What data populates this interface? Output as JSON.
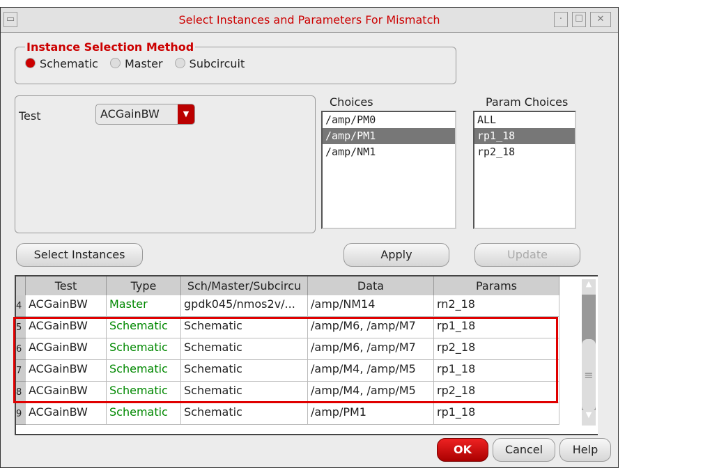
{
  "window": {
    "title": "Select Instances and Parameters For Mismatch"
  },
  "method": {
    "legend": "Instance Selection Method",
    "options": [
      {
        "label": "Schematic",
        "selected": true
      },
      {
        "label": "Master",
        "selected": false
      },
      {
        "label": "Subcircuit",
        "selected": false
      }
    ]
  },
  "test": {
    "label": "Test",
    "value": "ACGainBW"
  },
  "choices": {
    "label": "Choices",
    "items": [
      "/amp/PM0",
      "/amp/PM1",
      "/amp/NM1"
    ],
    "selected": "/amp/PM1"
  },
  "param_choices": {
    "label": "Param Choices",
    "items": [
      "ALL",
      "rp1_18",
      "rp2_18"
    ],
    "selected": "rp1_18"
  },
  "buttons": {
    "select_instances": "Select Instances",
    "apply": "Apply",
    "update": "Update",
    "ok": "OK",
    "cancel": "Cancel",
    "help": "Help"
  },
  "table": {
    "columns": [
      "Test",
      "Type",
      "Sch/Master/Subcircu",
      "Data",
      "Params"
    ],
    "rows": [
      {
        "n": "4",
        "test": "ACGainBW",
        "type": "Master",
        "sch": "gpdk045/nmos2v/...",
        "data": "/amp/NM14",
        "params": "rn2_18"
      },
      {
        "n": "5",
        "test": "ACGainBW",
        "type": "Schematic",
        "sch": "Schematic",
        "data": "/amp/M6, /amp/M7",
        "params": "rp1_18"
      },
      {
        "n": "6",
        "test": "ACGainBW",
        "type": "Schematic",
        "sch": "Schematic",
        "data": "/amp/M6, /amp/M7",
        "params": "rp2_18"
      },
      {
        "n": "7",
        "test": "ACGainBW",
        "type": "Schematic",
        "sch": "Schematic",
        "data": "/amp/M4, /amp/M5",
        "params": "rp1_18"
      },
      {
        "n": "8",
        "test": "ACGainBW",
        "type": "Schematic",
        "sch": "Schematic",
        "data": "/amp/M4, /amp/M5",
        "params": "rp2_18"
      },
      {
        "n": "9",
        "test": "ACGainBW",
        "type": "Schematic",
        "sch": "Schematic",
        "data": "/amp/PM1",
        "params": "rp1_18"
      }
    ]
  },
  "colors": {
    "accent": "#cc0000",
    "type_text": "#008800",
    "highlight_box": "#e00000"
  }
}
